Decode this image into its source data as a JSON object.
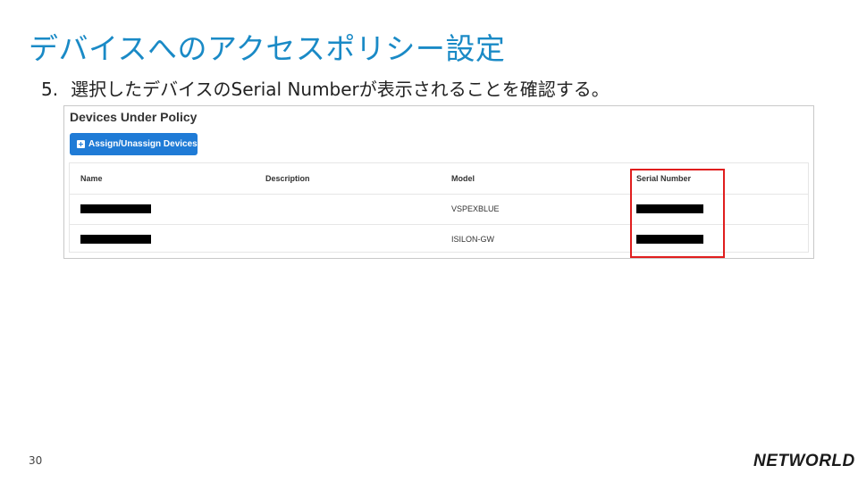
{
  "slide": {
    "title": "デバイスへのアクセスポリシー設定",
    "step_number": "5.",
    "step_text": "選択したデバイスのSerial Numberが表示されることを確認する。",
    "page_number": "30",
    "logo_text": "NETWORLD"
  },
  "panel": {
    "title": "Devices Under Policy",
    "assign_button_label": "Assign/Unassign Devices",
    "columns": [
      "Name",
      "Description",
      "Model",
      "Serial Number"
    ],
    "rows": [
      {
        "name": "[redacted]",
        "description": "",
        "model": "VSPEXBLUE",
        "serial": "[redacted]"
      },
      {
        "name": "[redacted]",
        "description": "",
        "model": "ISILON-GW",
        "serial": "[redacted]"
      }
    ]
  },
  "highlight": {
    "target": "Serial Number column",
    "color": "#e01e1e"
  },
  "colors": {
    "title": "#1a8ac6",
    "button": "#1f7bd6"
  },
  "icons": {
    "assign_button": "plus-square-icon"
  }
}
